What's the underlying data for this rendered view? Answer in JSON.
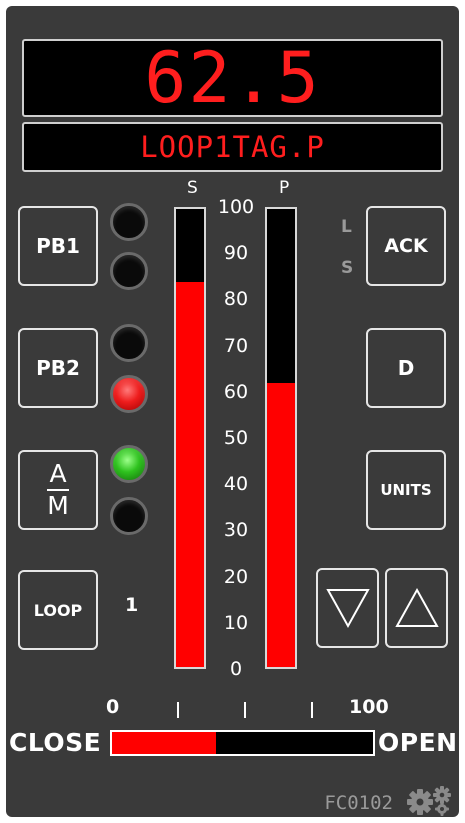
{
  "display": {
    "pv": "62.5",
    "tag": "LOOP1TAG.P"
  },
  "bars": {
    "s_label": "S",
    "p_label": "P",
    "s_value": 84,
    "p_value": 62,
    "fill_color": "#ff0000",
    "scale": [
      "100",
      "90",
      "80",
      "70",
      "60",
      "50",
      "40",
      "30",
      "20",
      "10",
      "0"
    ]
  },
  "buttons": {
    "pb1": "PB1",
    "pb2": "PB2",
    "am_top": "A",
    "am_bottom": "M",
    "loop": "LOOP",
    "ack": "ACK",
    "d": "D",
    "units": "UNITS"
  },
  "leds": {
    "pb1_top": "off",
    "pb1_bottom": "off",
    "pb2_top": "off",
    "pb2_bottom": "red",
    "am_top": "green",
    "am_bottom": "off"
  },
  "indicators": {
    "l": "L",
    "s": "S"
  },
  "loop_number": "1",
  "valve": {
    "close_label": "CLOSE",
    "open_label": "OPEN",
    "scale_min": "0",
    "scale_max": "100",
    "output": 40
  },
  "footer": {
    "station_id": "FC0102",
    "settings_icon": "gears-icon"
  }
}
